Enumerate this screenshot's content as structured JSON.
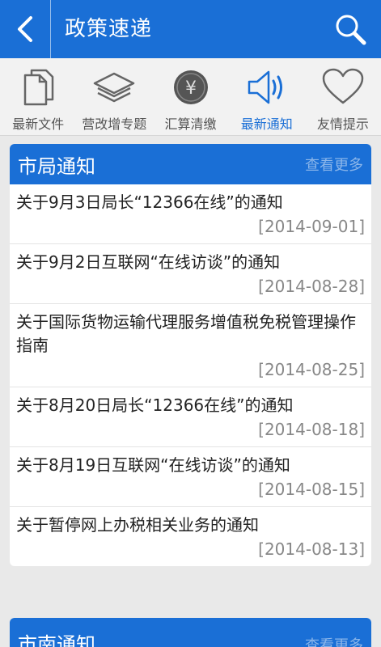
{
  "header": {
    "title": "政策速递"
  },
  "nav": [
    {
      "label": "最新文件",
      "icon": "documents-icon",
      "active": false
    },
    {
      "label": "营改增专题",
      "icon": "layers-icon",
      "active": false
    },
    {
      "label": "汇算清缴",
      "icon": "yen-coin-icon",
      "active": false
    },
    {
      "label": "最新通知",
      "icon": "speaker-icon",
      "active": true
    },
    {
      "label": "友情提示",
      "icon": "heart-icon",
      "active": false
    }
  ],
  "sections": [
    {
      "title": "市局通知",
      "more": "查看更多",
      "items": [
        {
          "title": "关于9月3日局长“12366在线”的通知",
          "date": "[2014-09-01]"
        },
        {
          "title": "关于9月2日互联网“在线访谈”的通知",
          "date": "[2014-08-28]"
        },
        {
          "title": "关于国际货物运输代理服务增值税免税管理操作指南",
          "date": "[2014-08-25]"
        },
        {
          "title": "关于8月20日局长“12366在线”的通知",
          "date": "[2014-08-18]"
        },
        {
          "title": "关于8月19日互联网“在线访谈”的通知",
          "date": "[2014-08-15]"
        },
        {
          "title": "关于暂停网上办税相关业务的通知",
          "date": "[2014-08-13]"
        }
      ]
    },
    {
      "title": "市南通知",
      "more": "查看更多",
      "items": []
    }
  ],
  "colors": {
    "primary": "#1a6fd6",
    "muted_link": "#8bb6ea",
    "date": "#888888"
  }
}
